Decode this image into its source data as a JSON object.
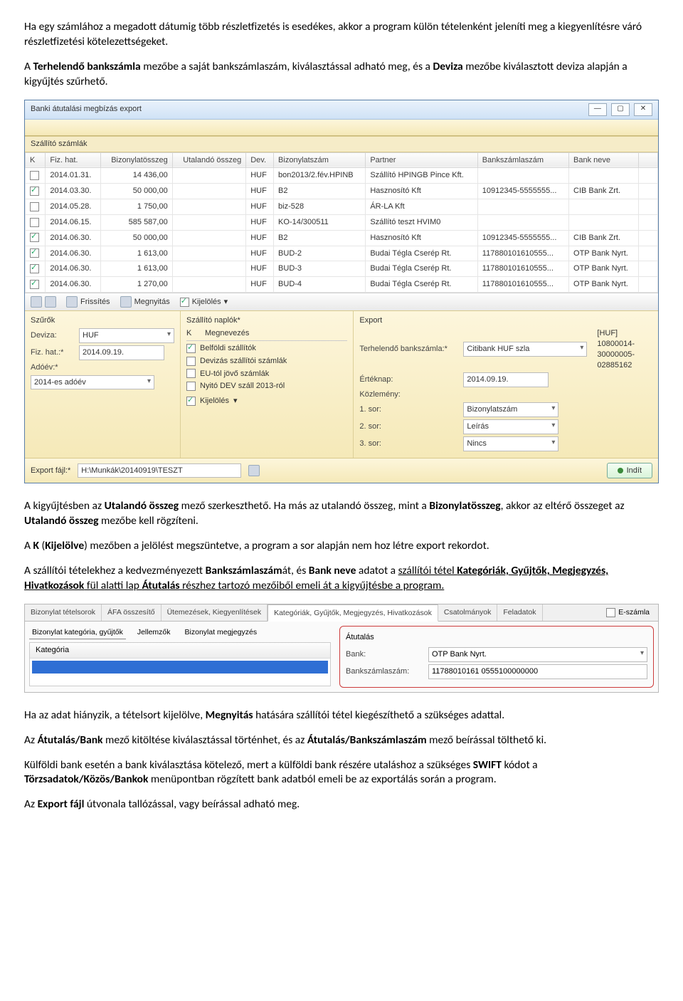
{
  "para1_a": "Ha egy számlához a megadott dátumig több részletfizetés is esedékes, akkor a program külön tételenként jeleníti meg a kiegyenlítésre váró részletfizetési kötelezettségeket.",
  "para2_pre": "A ",
  "para2_b1": "Terhelendő bankszámla",
  "para2_mid": " mezőbe a saját bankszámlaszám, kiválasztással adható meg, és a ",
  "para2_b2": "Deviza",
  "para2_end": " mezőbe kiválasztott deviza alapján a kigyűjtés szűrhető.",
  "win": {
    "title": "Banki átutalási megbízás export",
    "min": "—",
    "max": "▢",
    "close": "✕",
    "section": "Szállító számlák"
  },
  "cols": {
    "k": "K",
    "fiz": "Fiz. hat.",
    "bizo": "Bizonylatösszeg",
    "ut": "Utalandó összeg",
    "dev": "Dev.",
    "bizsz": "Bizonylatszám",
    "part": "Partner",
    "bank": "Bankszámlaszám",
    "bn": "Bank neve"
  },
  "rows": [
    {
      "k": false,
      "d": "2014.01.31.",
      "bo": "14 436,00",
      "uo": "",
      "dv": "HUF",
      "bs": "bon2013/2.fév.HPINB",
      "p": "Szállító HPINGB Pince Kft.",
      "ba": "",
      "bn": ""
    },
    {
      "k": true,
      "d": "2014.03.30.",
      "bo": "50 000,00",
      "uo": "",
      "dv": "HUF",
      "bs": "B2",
      "p": "Hasznosító Kft",
      "ba": "10912345-5555555...",
      "bn": "CIB Bank Zrt."
    },
    {
      "k": false,
      "d": "2014.05.28.",
      "bo": "1 750,00",
      "uo": "",
      "dv": "HUF",
      "bs": "biz-528",
      "p": "ÁR-LA Kft",
      "ba": "",
      "bn": ""
    },
    {
      "k": false,
      "d": "2014.06.15.",
      "bo": "585 587,00",
      "uo": "",
      "dv": "HUF",
      "bs": "KO-14/300511",
      "p": "Szállító teszt HVIM0",
      "ba": "",
      "bn": ""
    },
    {
      "k": true,
      "d": "2014.06.30.",
      "bo": "50 000,00",
      "uo": "",
      "dv": "HUF",
      "bs": "B2",
      "p": "Hasznosító Kft",
      "ba": "10912345-5555555...",
      "bn": "CIB Bank Zrt."
    },
    {
      "k": true,
      "d": "2014.06.30.",
      "bo": "1 613,00",
      "uo": "",
      "dv": "HUF",
      "bs": "BUD-2",
      "p": "Budai Tégla Cserép Rt.",
      "ba": "117880101610555...",
      "bn": "OTP Bank Nyrt."
    },
    {
      "k": true,
      "d": "2014.06.30.",
      "bo": "1 613,00",
      "uo": "",
      "dv": "HUF",
      "bs": "BUD-3",
      "p": "Budai Tégla Cserép Rt.",
      "ba": "117880101610555...",
      "bn": "OTP Bank Nyrt."
    },
    {
      "k": true,
      "d": "2014.06.30.",
      "bo": "1 270,00",
      "uo": "",
      "dv": "HUF",
      "bs": "BUD-4",
      "p": "Budai Tégla Cserép Rt.",
      "ba": "117880101610555...",
      "bn": "OTP Bank Nyrt."
    }
  ],
  "tb": {
    "refresh": "Frissítés",
    "open": "Megnyitás",
    "select": "Kijelölés"
  },
  "filters": {
    "title": "Szűrők",
    "dev_l": "Deviza:",
    "dev_v": "HUF",
    "fiz_l": "Fiz. hat.:*",
    "fiz_v": "2014.09.19.",
    "ado_l": "Adóév:*",
    "ado_v": "2014-es adóév"
  },
  "naplo": {
    "title": "Szállító naplók*",
    "k": "K",
    "meg": "Megnevezés",
    "r1": "Belföldi szállítók",
    "r2": "Devizás szállítói számlák",
    "r3": "EU-tól jövő számlák",
    "r4": "Nyitó DEV száll 2013-ról",
    "sel": "Kijelölés"
  },
  "exp": {
    "title": "Export",
    "bank_l": "Terhelendő bankszámla:*",
    "bank_v": "Citibank HUF szla",
    "bank_no": "[HUF] 10800014-30000005-02885162",
    "ert_l": "Értéknap:",
    "ert_v": "2014.09.19.",
    "koz_l": "Közlemény:",
    "s1_l": "1. sor:",
    "s1_v": "Bizonylatszám",
    "s2_l": "2. sor:",
    "s2_v": "Leírás",
    "s3_l": "3. sor:",
    "s3_v": "Nincs"
  },
  "ef": {
    "l": "Export fájl:*",
    "v": "H:\\Munkák\\20140919\\TESZT",
    "go": "Indít"
  },
  "para3_pre": "A kigyűjtésben az ",
  "para3_b1": "Utalandó összeg",
  "para3_mid": " mező szerkeszthető. Ha más az utalandó összeg, mint a ",
  "para3_b2": "Bizonylatösszeg",
  "para3_mid2": ", akkor az eltérő összeget az ",
  "para3_b3": "Utalandó összeg",
  "para3_end": " mezőbe kell rögzíteni.",
  "para4_pre": "A ",
  "para4_b1": "K",
  "para4_mid": " (",
  "para4_b2": "Kijelölve",
  "para4_end": ") mezőben a jelölést megszüntetve, a program a sor alapján nem hoz létre export rekordot.",
  "para5_pre": "A szállítói tételekhez a kedvezményezett ",
  "para5_b1": "Bankszámlaszám",
  "para5_mid1": "át, és ",
  "para5_b2": "Bank neve",
  "para5_mid2": " adatot a ",
  "para5_u1": "szállítói tétel ",
  "para5_b3": "Kategóriák, Gyűjtők, Megjegyzés, Hivatkozások",
  "para5_mid3": " fül alatti lap ",
  "para5_b4": "Átutalás",
  "para5_end": " részhez tartozó mezőiből emeli át a kigyűjtésbe a program.",
  "tabs": {
    "t1": "Bizonylat tételsorok",
    "t2": "ÁFA összesítő",
    "t3": "Ütemezések, Kiegyenlítések",
    "t4": "Kategóriák, Gyűjtők, Megjegyzés, Hivatkozások",
    "t5": "Csatolmányok",
    "t6": "Feladatok",
    "esz": "E-számla"
  },
  "sub": {
    "s1": "Bizonylat kategória, gyűjtők",
    "s2": "Jellemzők",
    "s3": "Bizonylat megjegyzés",
    "kat": "Kategória"
  },
  "atu": {
    "t": "Átutalás",
    "bank_l": "Bank:",
    "bank_v": "OTP Bank Nyrt.",
    "szla_l": "Bankszámlaszám:",
    "szla_v": "11788010161 0555100000000"
  },
  "para6_pre": "Ha az adat hiányzik, a tételsort kijelölve, ",
  "para6_b": "Megnyitás",
  "para6_end": " hatására szállítói tétel kiegészíthető a szükséges adattal.",
  "para7_pre": "Az ",
  "para7_b1": "Átutalás/Bank",
  "para7_mid": " mező kitöltése kiválasztással történhet, és az ",
  "para7_b2": "Átutalás/Bankszámlaszám",
  "para7_end": " mező beírással tölthető ki.",
  "para8_pre": "Külföldi bank esetén a bank kiválasztása kötelező, mert a külföldi bank részére utaláshoz a szükséges ",
  "para8_b1": "SWIFT",
  "para8_mid": " kódot a ",
  "para8_b2": "Törzsadatok/Közös/Bankok",
  "para8_end": " menüpontban rögzített bank adatból emeli be az exportálás során a program.",
  "para9_pre": "Az ",
  "para9_b": "Export fájl",
  "para9_end": " útvonala tallózással, vagy beírással adható meg."
}
